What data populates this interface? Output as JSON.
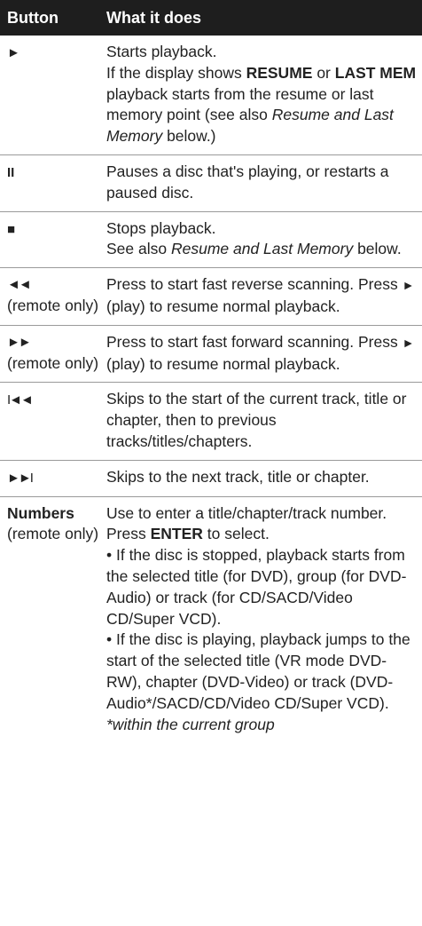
{
  "header": {
    "button": "Button",
    "what": "What it does"
  },
  "rows": [
    {
      "button_symbol": "►",
      "button_name": "play-button-symbol",
      "lines": [
        {
          "text": "Starts playback."
        },
        {
          "a": "If the display shows ",
          "b1": "RESUME",
          "c": " or ",
          "b2": "LAST MEM",
          "d": " playback starts from the resume or last memory point (see also ",
          "i": "Resume and Last Memory",
          "e": " below.)"
        }
      ]
    },
    {
      "button_symbol": "II",
      "lines": [
        {
          "text": "Pauses a disc that's playing, or restarts a paused disc."
        }
      ]
    },
    {
      "button_symbol": "■",
      "lines": [
        {
          "text": "Stops playback."
        },
        {
          "a": "See also ",
          "i": "Resume and Last Memory",
          "e": " below."
        }
      ]
    },
    {
      "button_symbol": "◄◄",
      "button_note": "(remote only)",
      "lines": [
        {
          "a": "Press to start fast reverse scanning. Press ",
          "sym": "►",
          "e": " (play) to resume normal playback."
        }
      ]
    },
    {
      "button_symbol": "►►",
      "button_note": "(remote only)",
      "lines": [
        {
          "a": "Press to start fast forward scanning. Press ",
          "sym": "►",
          "e": " (play) to resume normal playback."
        }
      ]
    },
    {
      "button_symbol": "I◄◄",
      "lines": [
        {
          "text": "Skips to the start of the current track, title or chapter, then to previous tracks/titles/chapters."
        }
      ]
    },
    {
      "button_symbol": "►►I",
      "lines": [
        {
          "text": "Skips to the next track, title or chapter."
        }
      ]
    },
    {
      "button_label": "Numbers",
      "button_note": "(remote only)",
      "lines": [
        {
          "a": "Use to enter a title/chapter/track number. Press ",
          "b1": "ENTER",
          "e": " to select."
        },
        {
          "text": "• If the disc is stopped, playback starts from the selected title (for DVD), group (for DVD-Audio) or track (for CD/SACD/Video CD/Super VCD)."
        },
        {
          "text": "• If the disc is playing, playback jumps to the start of the selected title (VR mode DVD-RW), chapter (DVD-Video) or track (DVD-Audio*/SACD/CD/Video CD/Super VCD)."
        },
        {
          "note": "*within the current group"
        }
      ]
    }
  ]
}
